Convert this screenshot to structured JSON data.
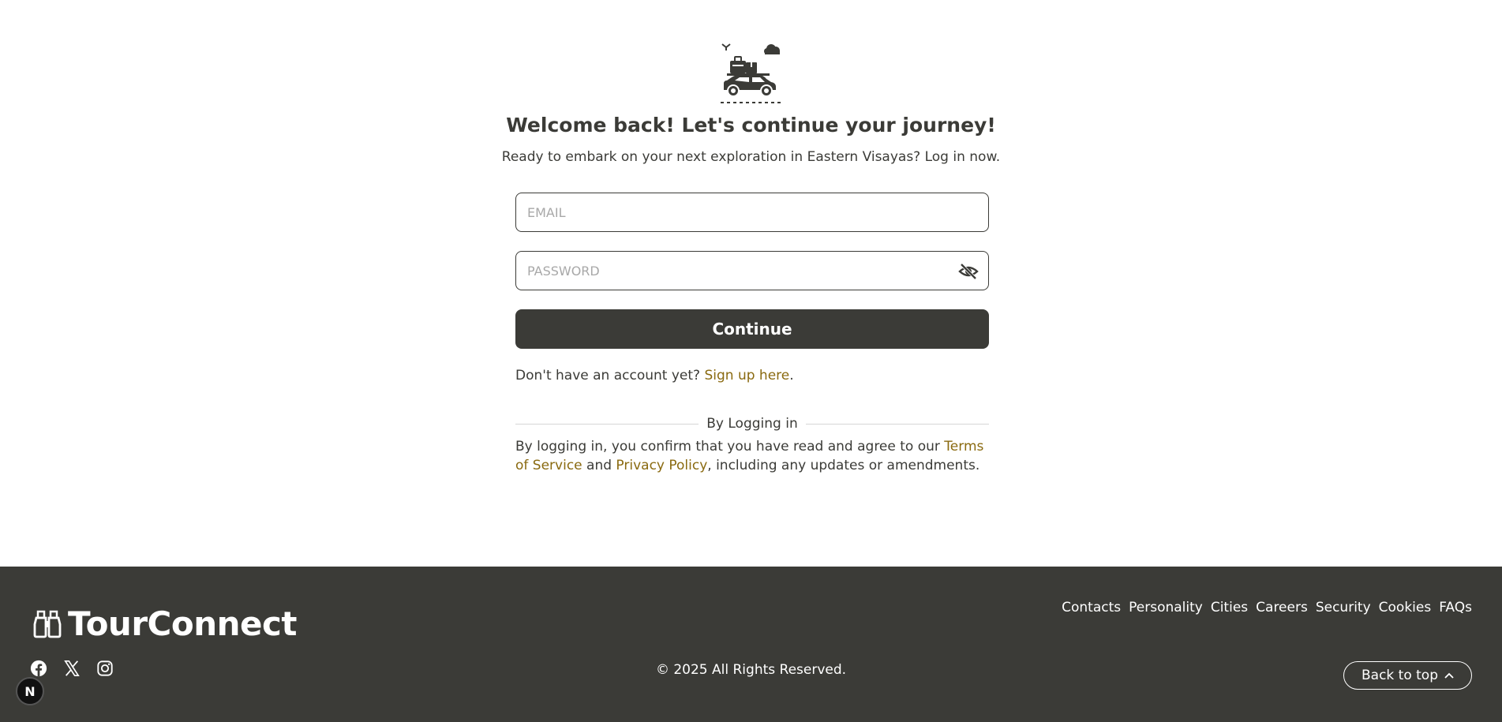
{
  "login": {
    "hero_icon": "car-travel-icon",
    "title": "Welcome back! Let's continue your journey!",
    "subtitle": "Ready to embark on your next exploration in Eastern Visayas? Log in now.",
    "email_placeholder": "EMAIL",
    "password_placeholder": "PASSWORD",
    "eye_icon": "eye-slash-icon",
    "continue_label": "Continue",
    "signup_prefix": "Don't have an account yet? ",
    "signup_link": "Sign up here",
    "signup_suffix": ".",
    "divider_text": "By Logging in",
    "terms_prefix": "By logging in, you confirm that you have read and agree to our ",
    "terms_link": "Terms of Service",
    "terms_middle": " and ",
    "privacy_link": "Privacy Policy",
    "terms_suffix": ", including any updates or amendments."
  },
  "footer": {
    "brand_name": "TourConnect",
    "brand_icon": "binoculars-icon",
    "links": [
      "Contacts",
      "Personality",
      "Cities",
      "Careers",
      "Security",
      "Cookies",
      "FAQs"
    ],
    "social_icons": [
      "facebook-icon",
      "x-icon",
      "instagram-icon"
    ],
    "copyright": "© 2025 All Rights Reserved.",
    "back_to_top": "Back to top"
  },
  "badge": {
    "label": "N"
  },
  "colors": {
    "primary": "#3b3b37",
    "link": "#8a6a10",
    "background": "#ffffff",
    "footer_text": "#ffffff"
  }
}
